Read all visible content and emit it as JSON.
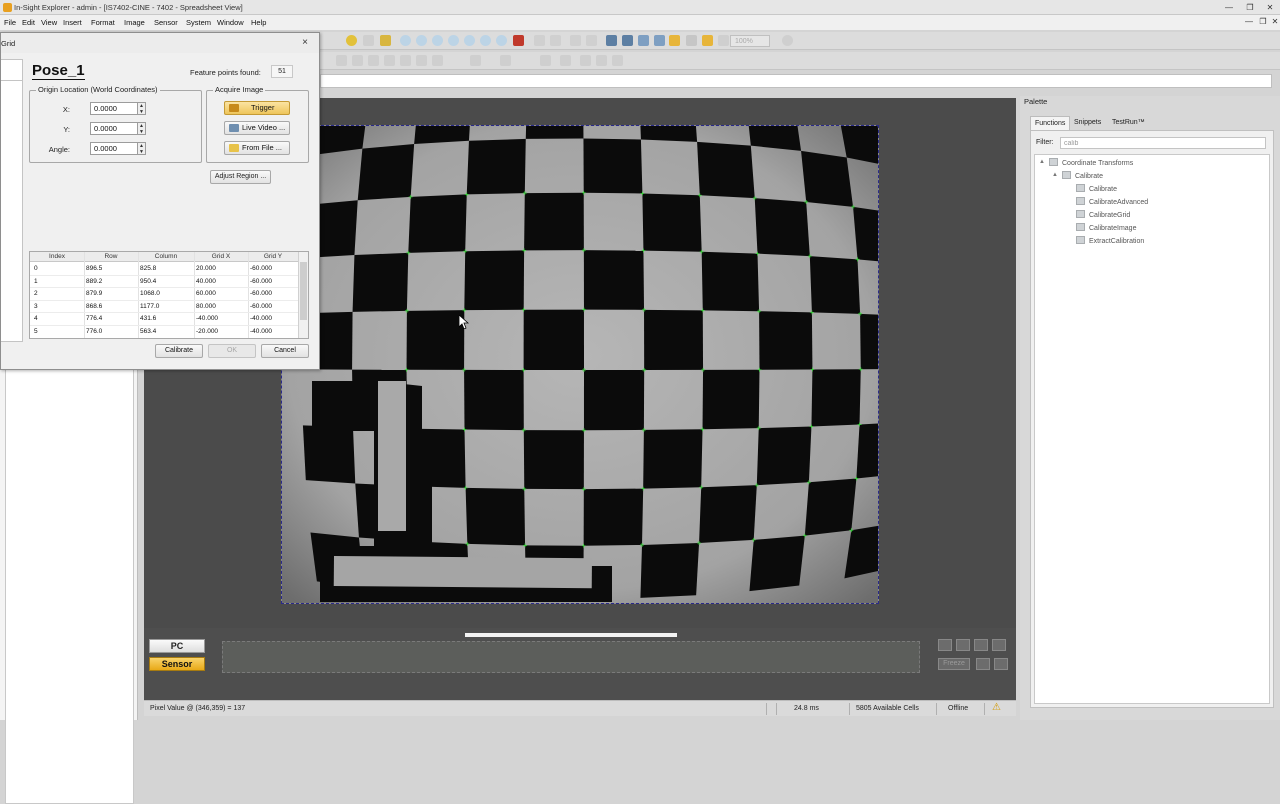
{
  "window": {
    "title": "In-Sight Explorer - admin - [IS7402-CINE - 7402 - Spreadsheet View]",
    "min": "—",
    "restore": "❐",
    "close": "✕",
    "inner_min": "—",
    "inner_restore": "❐",
    "inner_close": "✕"
  },
  "menu": [
    "File",
    "Edit",
    "View",
    "Insert",
    "Format",
    "Image",
    "Sensor",
    "System",
    "Window",
    "Help"
  ],
  "toolbar": {
    "zoom": "100%"
  },
  "dialog": {
    "title": "Grid",
    "close": "×",
    "pose_title": "Pose_1",
    "feature_points_label": "Feature points found:",
    "feature_points_value": "51",
    "origin_group_label": "Origin Location (World Coordinates)",
    "x_label": "X:",
    "x_value": "0.0000",
    "y_label": "Y:",
    "y_value": "0.0000",
    "angle_label": "Angle:",
    "angle_value": "0.0000",
    "acquire_group_label": "Acquire Image",
    "trigger_label": "Trigger",
    "live_video_label": "Live Video ...",
    "from_file_label": "From File ...",
    "adjust_region_label": "Adjust Region ...",
    "table": {
      "headers": [
        "Index",
        "Row",
        "Column",
        "Grid X",
        "Grid Y"
      ],
      "rows": [
        [
          "0",
          "896.5",
          "825.8",
          "20.000",
          "-60.000"
        ],
        [
          "1",
          "889.2",
          "950.4",
          "40.000",
          "-60.000"
        ],
        [
          "2",
          "879.9",
          "1068.0",
          "60.000",
          "-60.000"
        ],
        [
          "3",
          "868.6",
          "1177.0",
          "80.000",
          "-60.000"
        ],
        [
          "4",
          "776.4",
          "431.6",
          "-40.000",
          "-40.000"
        ],
        [
          "5",
          "776.0",
          "563.4",
          "-20.000",
          "-40.000"
        ]
      ]
    },
    "calibrate_label": "Calibrate",
    "ok_label": "OK",
    "cancel_label": "Cancel"
  },
  "filmstrip": {
    "pc_label": "PC",
    "sensor_label": "Sensor",
    "freeze_label": "Freeze",
    "colors": {
      "sensor": "#e8a917",
      "pc": "#eeeeee"
    }
  },
  "status": {
    "pixel_value": "Pixel Value @ (346,359) = 137",
    "time": "24.8 ms",
    "cells": "5805 Available Cells",
    "mode": "Offline",
    "warning_icon": "⚠"
  },
  "palette": {
    "header": "Palette",
    "tabs": [
      "Functions",
      "Snippets",
      "TestRun™"
    ],
    "filter_label": "Filter:",
    "filter_value": "calib",
    "tree": {
      "root": "Coordinate Transforms",
      "group": "Calibrate",
      "items": [
        "Calibrate",
        "CalibrateAdvanced",
        "CalibrateGrid",
        "CalibrateImage",
        "ExtractCalibration"
      ]
    }
  },
  "icons": {
    "app": "app-icon",
    "tree_arrow_open": "▲",
    "spin_up": "▲",
    "spin_down": "▼"
  }
}
